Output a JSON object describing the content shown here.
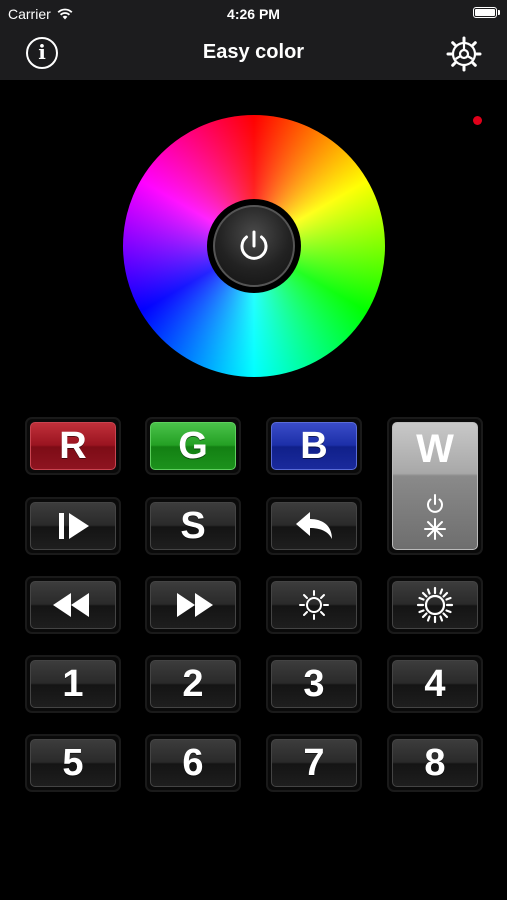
{
  "status_bar": {
    "carrier": "Carrier",
    "time": "4:26 PM"
  },
  "nav": {
    "title": "Easy color"
  },
  "colors": {
    "connection_indicator": "#e0001a",
    "red": "#9a1420",
    "green": "#24a024",
    "blue": "#1c2fa8",
    "white": "#a8a8a8"
  },
  "buttons": {
    "r": "R",
    "g": "G",
    "b": "B",
    "w": "W",
    "speed": "S",
    "numbers": [
      "1",
      "2",
      "3",
      "4",
      "5",
      "6",
      "7",
      "8"
    ]
  },
  "icons": {
    "info": "info-icon",
    "settings": "gear-icon",
    "power": "power-icon",
    "play": "play-icon",
    "back": "back-arrow-icon",
    "rewind": "rewind-icon",
    "fast_forward": "fast-forward-icon",
    "brightness_down": "brightness-down-icon",
    "brightness_up": "brightness-up-icon",
    "white_mode": "power-sun-icon"
  }
}
